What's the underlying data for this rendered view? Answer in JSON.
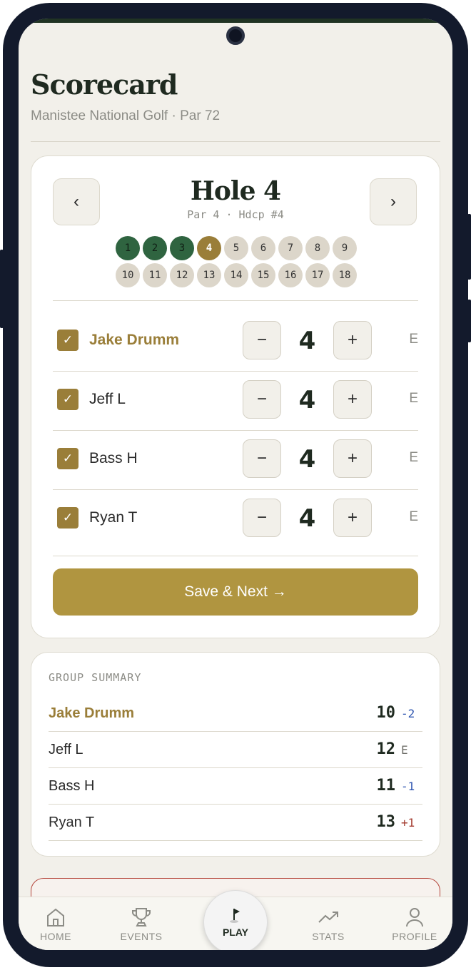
{
  "header": {
    "title": "Scorecard",
    "course": "Manistee National Golf · Par 72"
  },
  "hole": {
    "title": "Hole 4",
    "meta": "Par 4 · Hdcp #4",
    "prev": "‹",
    "next": "›",
    "current": 4,
    "holes": [
      "1",
      "2",
      "3",
      "4",
      "5",
      "6",
      "7",
      "8",
      "9",
      "10",
      "11",
      "12",
      "13",
      "14",
      "15",
      "16",
      "17",
      "18"
    ]
  },
  "players": [
    {
      "name": "Jake Drumm",
      "score": "4",
      "to_par": "E",
      "checked": true,
      "me": true
    },
    {
      "name": "Jeff L",
      "score": "4",
      "to_par": "E",
      "checked": true,
      "me": false
    },
    {
      "name": "Bass H",
      "score": "4",
      "to_par": "E",
      "checked": true,
      "me": false
    },
    {
      "name": "Ryan T",
      "score": "4",
      "to_par": "E",
      "checked": true,
      "me": false
    }
  ],
  "controls": {
    "minus": "−",
    "plus": "+",
    "check": "✓"
  },
  "save_label": "Save & Next →",
  "summary": {
    "title": "GROUP SUMMARY",
    "rows": [
      {
        "name": "Jake Drumm",
        "total": "10",
        "diff": "-2",
        "me": true
      },
      {
        "name": "Jeff L",
        "total": "12",
        "diff": "E",
        "me": false
      },
      {
        "name": "Bass H",
        "total": "11",
        "diff": "-1",
        "me": false
      },
      {
        "name": "Ryan T",
        "total": "13",
        "diff": "+1",
        "me": false
      }
    ]
  },
  "colors": {
    "under": "#2f56b0",
    "even": "#6f6f6a",
    "over": "#a33a2e"
  },
  "tabs": {
    "home": "HOME",
    "events": "EVENTS",
    "play": "PLAY",
    "stats": "STATS",
    "profile": "PROFILE"
  }
}
